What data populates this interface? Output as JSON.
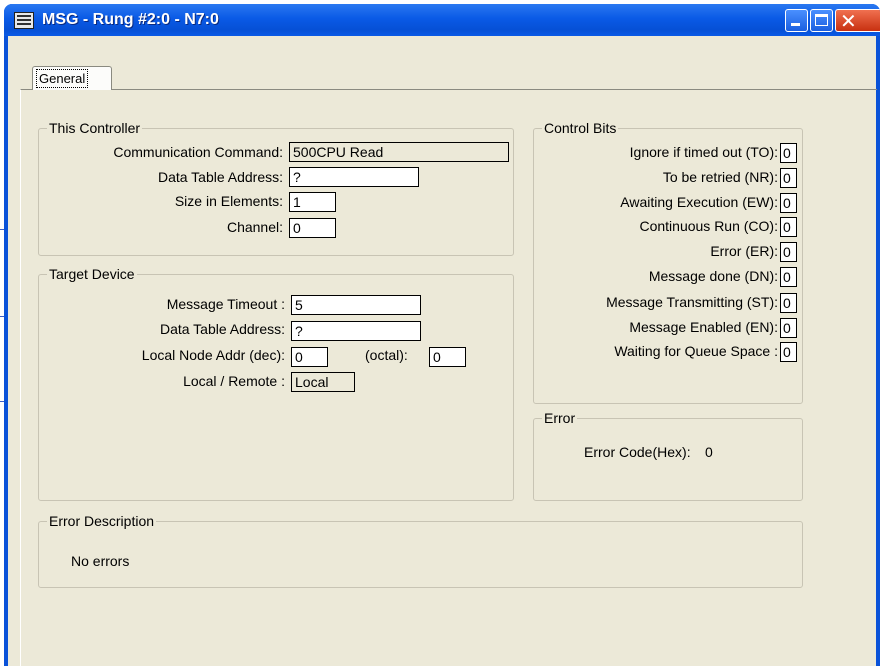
{
  "window": {
    "title": "MSG - Rung #2:0 - N7:0"
  },
  "tabs": [
    {
      "label": "General"
    }
  ],
  "this_controller": {
    "title": "This Controller",
    "communication_command": {
      "label": "Communication Command:",
      "value": "500CPU Read"
    },
    "data_table_address": {
      "label": "Data Table Address:",
      "value": "?"
    },
    "size_in_elements": {
      "label": "Size in Elements:",
      "value": "1"
    },
    "channel": {
      "label": "Channel:",
      "value": "0"
    }
  },
  "target_device": {
    "title": "Target Device",
    "message_timeout": {
      "label": "Message Timeout :",
      "value": "5"
    },
    "data_table_address": {
      "label": "Data Table Address:",
      "value": "?"
    },
    "local_node_addr": {
      "label": "Local Node Addr (dec):",
      "value": "0"
    },
    "octal": {
      "label": "(octal):",
      "value": "0"
    },
    "local_remote": {
      "label": "Local / Remote :",
      "value": "Local"
    }
  },
  "control_bits": {
    "title": "Control Bits",
    "items": [
      {
        "label": "Ignore if timed out (TO):",
        "value": "0"
      },
      {
        "label": "To be retried (NR):",
        "value": "0"
      },
      {
        "label": "Awaiting Execution (EW):",
        "value": "0"
      },
      {
        "label": "Continuous Run (CO):",
        "value": "0"
      },
      {
        "label": "Error (ER):",
        "value": "0"
      },
      {
        "label": "Message done (DN):",
        "value": "0"
      },
      {
        "label": "Message Transmitting (ST):",
        "value": "0"
      },
      {
        "label": "Message Enabled (EN):",
        "value": "0"
      },
      {
        "label": "Waiting for Queue Space :",
        "value": "0"
      }
    ]
  },
  "error": {
    "title": "Error",
    "code_label": "Error Code(Hex):",
    "code_value": "0"
  },
  "error_description": {
    "title": "Error Description",
    "text": "No errors"
  },
  "icons": [
    "app-icon",
    "minimize-icon",
    "maximize-icon",
    "close-icon"
  ],
  "colors": {
    "titlebar": "#0a5ae6",
    "close_button": "#d84a28",
    "dialog_bg": "#ece9d8"
  }
}
